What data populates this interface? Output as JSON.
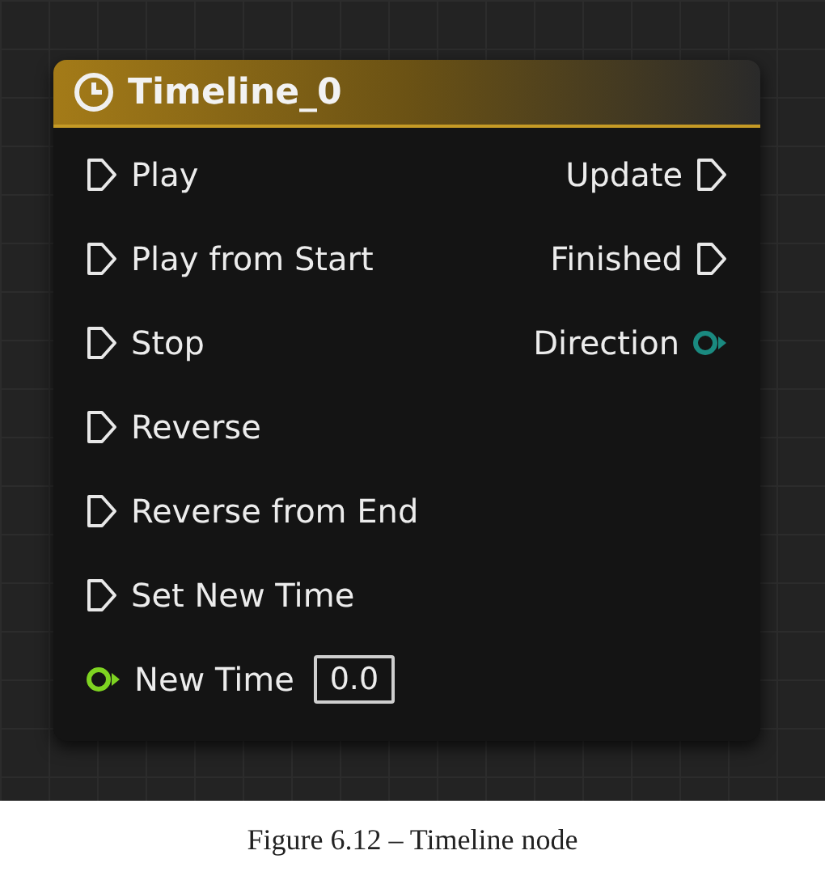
{
  "node": {
    "title": "Timeline_0",
    "inputs": [
      {
        "kind": "exec",
        "label": "Play"
      },
      {
        "kind": "exec",
        "label": "Play from Start"
      },
      {
        "kind": "exec",
        "label": "Stop"
      },
      {
        "kind": "exec",
        "label": "Reverse"
      },
      {
        "kind": "exec",
        "label": "Reverse from End"
      },
      {
        "kind": "exec",
        "label": "Set New Time"
      },
      {
        "kind": "data",
        "label": "New Time",
        "color": "#7ed321",
        "value": "0.0"
      }
    ],
    "outputs": [
      {
        "kind": "exec",
        "label": "Update"
      },
      {
        "kind": "exec",
        "label": "Finished"
      },
      {
        "kind": "data",
        "label": "Direction",
        "color": "#1a8a80"
      }
    ]
  },
  "caption": "Figure 6.12 – Timeline node"
}
